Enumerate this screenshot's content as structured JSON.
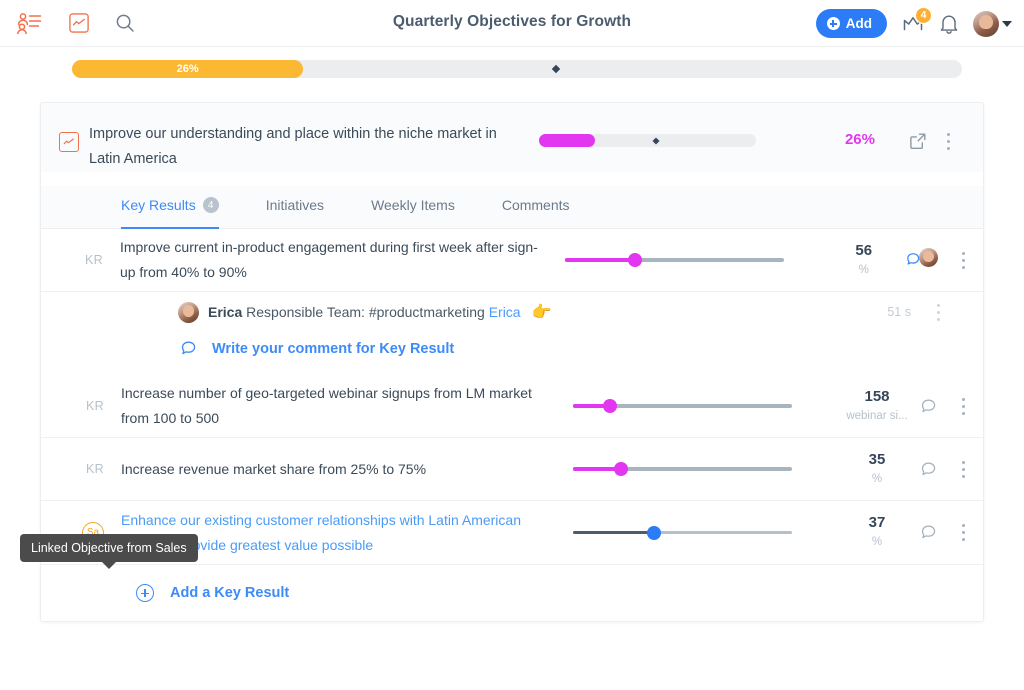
{
  "topbar": {
    "icons": [
      {
        "name": "team-icon",
        "label": "Team"
      },
      {
        "name": "objectives-chart-icon",
        "label": "Objectives"
      },
      {
        "name": "search-icon",
        "label": "Search"
      }
    ],
    "title": "Quarterly Objectives for Growth",
    "add_button_label": "Add",
    "crown_badge_count": "4",
    "bell_label": "Notifications",
    "avatar_label": "Erica"
  },
  "top_progress": {
    "percent_label": "26%",
    "percent_value": 26,
    "marker_value": 54.4
  },
  "objective": {
    "title": "Improve our understanding and place within the niche market in Latin America",
    "progress_label": "26%",
    "progress_value": 26,
    "marker_value": 54,
    "open_label": "Open in new tab",
    "menu_label": "More options"
  },
  "tabs": [
    {
      "label": "Key Results",
      "count": "4",
      "active": true
    },
    {
      "label": "Initiatives",
      "count": "",
      "active": false
    },
    {
      "label": "Weekly Items",
      "count": "",
      "active": false
    },
    {
      "label": "Comments",
      "count": "",
      "active": false
    }
  ],
  "key_results": [
    {
      "badge": "KR",
      "title": "Improve current in-product engagement during first week after sign-up from 40% to 90%",
      "slider_value": 32,
      "value": "56",
      "unit": "%"
    },
    {
      "badge": "KR",
      "title": "Increase number of geo-targeted webinar signups from LM market from 100 to 500",
      "slider_value": 17,
      "value": "158",
      "unit": "webinar si..."
    },
    {
      "badge": "KR",
      "title": "Increase revenue market share from 25% to 75%",
      "slider_value": 22,
      "value": "35",
      "unit": "%"
    },
    {
      "badge": "Sa",
      "title": "Enhance our existing customer relationships with Latin American clients to provide greatest value possible",
      "slider_value": 37,
      "value": "37",
      "unit": "%"
    }
  ],
  "comment": {
    "author": "Erica",
    "body": "Responsible Team: #productmarketing",
    "mention": "Erica",
    "emoji": "👉",
    "time": "51 s",
    "write_placeholder": "Write your comment for Key Result"
  },
  "add_key_result_label": "Add a Key Result",
  "tooltip": {
    "text": "Linked Objective from Sales"
  },
  "colors": {
    "accent_blue": "#2b7cf6",
    "magenta": "#e336f0",
    "amber": "#fbb833",
    "orange": "#f2714d"
  }
}
